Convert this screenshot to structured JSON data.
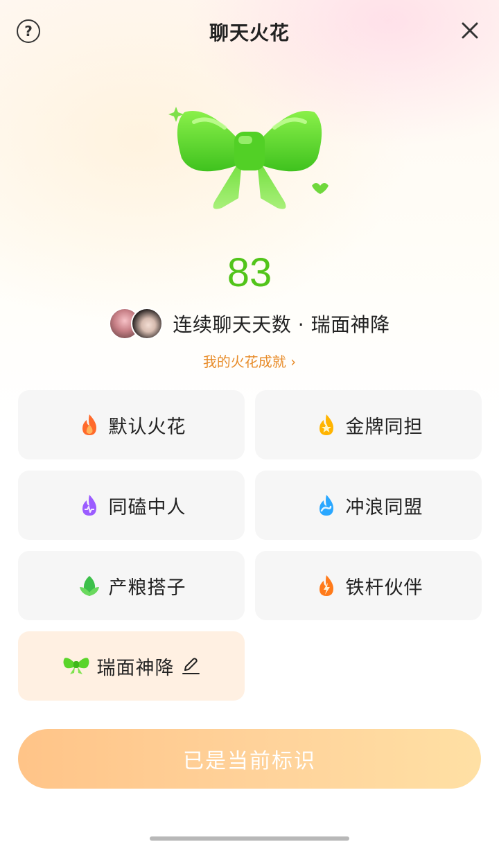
{
  "header": {
    "title": "聊天火花",
    "help_icon": "question-circle-icon",
    "close_icon": "close-icon"
  },
  "hero": {
    "icon": "green-bow-icon",
    "count": "83",
    "streak_label": "连续聊天天数 · 瑞面神降",
    "achievements_link": "我的火花成就 ›"
  },
  "options": [
    {
      "label": "默认火花",
      "icon": "default-flame-icon",
      "color": "#ff6a2b"
    },
    {
      "label": "金牌同担",
      "icon": "gold-star-flame-icon",
      "color": "#ffb400"
    },
    {
      "label": "同磕中人",
      "icon": "purple-flame-icon",
      "color": "#9b5cff"
    },
    {
      "label": "冲浪同盟",
      "icon": "wave-flame-icon",
      "color": "#2aa7ff"
    },
    {
      "label": "产粮搭子",
      "icon": "leaf-flame-icon",
      "color": "#3cc04a"
    },
    {
      "label": "铁杆伙伴",
      "icon": "lightning-flame-icon",
      "color": "#ff7a1a"
    },
    {
      "label": "瑞面神降",
      "icon": "green-bow-icon",
      "color": "#5ad42a",
      "selected": true
    }
  ],
  "primary_button": {
    "label": "已是当前标识"
  },
  "colors": {
    "accent_green": "#52c41a",
    "link_orange": "#e88c2a",
    "selected_bg": "#fff0e2"
  }
}
